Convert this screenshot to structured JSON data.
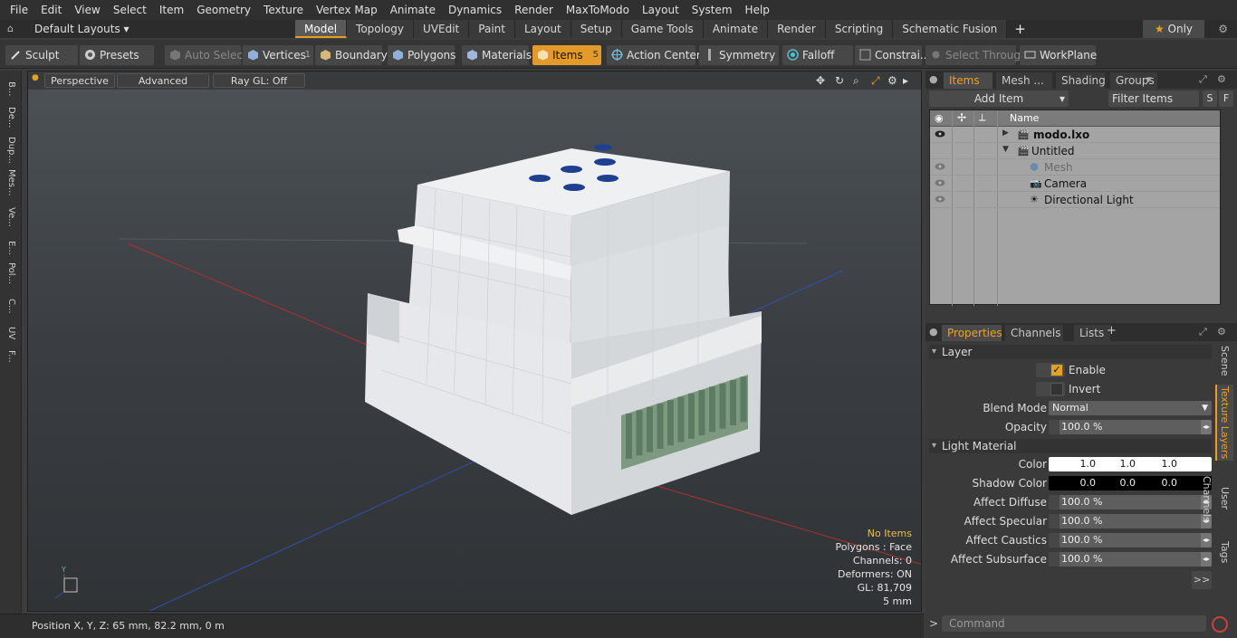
{
  "menubar": [
    "File",
    "Edit",
    "View",
    "Select",
    "Item",
    "Geometry",
    "Texture",
    "Vertex Map",
    "Animate",
    "Dynamics",
    "Render",
    "MaxToModo",
    "Layout",
    "System",
    "Help"
  ],
  "tabbar": {
    "layout": "Default Layouts",
    "tabs": [
      "Model",
      "Topology",
      "UVEdit",
      "Paint",
      "Layout",
      "Setup",
      "Game Tools",
      "Animate",
      "Render",
      "Scripting",
      "Schematic Fusion"
    ],
    "active_tab": "Model",
    "plus": "+",
    "only": "Only"
  },
  "toolbar": {
    "sculpt": "Sculpt",
    "presets": "Presets",
    "auto_select": "Auto Select",
    "vertices": "Vertices",
    "vertices_count": "1",
    "boundary": "Boundary",
    "polygons": "Polygons",
    "materials": "Materials",
    "items": "Items",
    "items_count": "5",
    "action_center": "Action Center",
    "symmetry": "Symmetry",
    "falloff": "Falloff",
    "constraints": "Constrai...",
    "select_through": "Select Through",
    "workplane": "WorkPlane"
  },
  "lefttabs": [
    "B...",
    "De...",
    "Dup...",
    "Mes...",
    "Ve...",
    "E...",
    "Pol...",
    "C...",
    "UV",
    "F..."
  ],
  "viewport": {
    "perspective": "Perspective",
    "advanced": "Advanced",
    "raygl": "Ray GL: Off",
    "info": {
      "no_items": "No Items",
      "polygons": "Polygons : Face",
      "channels": "Channels: 0",
      "deformers": "Deformers: ON",
      "gl": "GL: 81,709",
      "scale": "5 mm"
    },
    "axis_y": "Y"
  },
  "statusbar": "Position X, Y, Z:   65 mm, 82.2 mm, 0 m",
  "items_panel": {
    "tabs": [
      "Items",
      "Mesh ...",
      "Shading",
      "Groups"
    ],
    "add_item": "Add Item",
    "filter": "Filter Items",
    "s": "S",
    "f": "F",
    "col_name": "Name",
    "rows": [
      "modo.lxo",
      "Untitled",
      "Mesh",
      "Camera",
      "Directional Light"
    ]
  },
  "properties": {
    "tabs": [
      "Properties",
      "Channels",
      "Lists"
    ],
    "plus": "+",
    "layer": "Layer",
    "enable": "Enable",
    "invert": "Invert",
    "blend_mode_label": "Blend Mode",
    "blend_mode": "Normal",
    "opacity_label": "Opacity",
    "opacity": "100.0 %",
    "light_material": "Light Material",
    "color_label": "Color",
    "color": [
      "1.0",
      "1.0",
      "1.0"
    ],
    "shadow_label": "Shadow Color",
    "shadow": [
      "0.0",
      "0.0",
      "0.0"
    ],
    "affect_diffuse_label": "Affect Diffuse",
    "affect_diffuse": "100.0 %",
    "affect_specular_label": "Affect Specular",
    "affect_specular": "100.0 %",
    "affect_caustics_label": "Affect Caustics",
    "affect_caustics": "100.0 %",
    "affect_subsurface_label": "Affect Subsurface",
    "affect_subsurface": "100.0 %",
    "more": ">>",
    "side_tabs": [
      "Scene",
      "Texture Layers",
      "User Channels",
      "Tags"
    ],
    "command": "Command",
    "prompt": ">"
  },
  "colors": {
    "accent": "#e8a020",
    "viewport_bg": "#43474b",
    "list_bg": "#a4a4a4"
  }
}
